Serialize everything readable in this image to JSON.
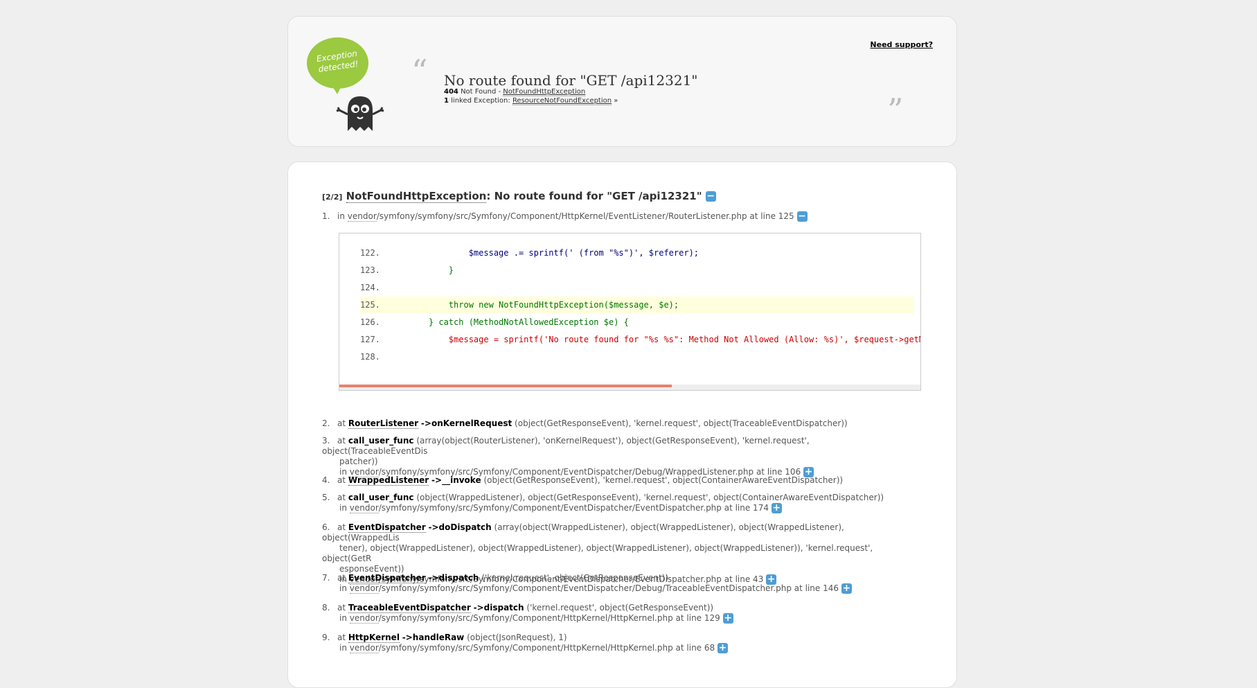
{
  "header": {
    "bubble_text": "Exception detected!",
    "support_link": "Need support?",
    "title": "No route found for \"GET /api12321\"",
    "status_code": "404",
    "status_text": "Not Found -",
    "exception_class": "NotFoundHttpException",
    "linked_count": "1",
    "linked_label": "linked Exception:",
    "linked_class": "ResourceNotFoundException",
    "linked_arrow": "»"
  },
  "exception": {
    "counter": "[2/2]",
    "class": "NotFoundHttpException",
    "message": ": No route found for \"GET /api12321\"",
    "toggle": "−"
  },
  "code": {
    "lines": [
      {
        "n": "122.",
        "code": "            $message .= sprintf(' (from \"%s\")', $referer);"
      },
      {
        "n": "123.",
        "code": "        }"
      },
      {
        "n": "124.",
        "code": ""
      },
      {
        "n": "125.",
        "code": "        throw new NotFoundHttpException($message, $e);"
      },
      {
        "n": "126.",
        "code": "    } catch (MethodNotAllowedException $e) {"
      },
      {
        "n": "127.",
        "code": "        $message = sprintf('No route found for \"%s %s\": Method Not Allowed (Allow: %s)', $request->getMeth"
      },
      {
        "n": "128.",
        "code": ""
      }
    ]
  },
  "trace": [
    {
      "n": "1.",
      "prefix": "in",
      "vendor": "vendor",
      "path": "/symfony/symfony/src/Symfony/Component/HttpKernel/EventListener/RouterListener.php at line 125",
      "toggle": "−"
    },
    {
      "n": "2.",
      "prefix": "at",
      "cls": "RouterListener",
      "fn": "->onKernelRequest",
      "args": "(object(GetResponseEvent), 'kernel.request', object(TraceableEventDispatcher))"
    },
    {
      "n": "3.",
      "prefix": "at",
      "fn": "call_user_func",
      "args": "(array(object(RouterListener), 'onKernelRequest'), object(GetResponseEvent), 'kernel.request', object(TraceableEventDis",
      "args2": "patcher))",
      "vendor": "vendor",
      "path": "/symfony/symfony/src/Symfony/Component/EventDispatcher/Debug/WrappedListener.php at line 106",
      "toggle": "+"
    },
    {
      "n": "4.",
      "prefix": "at",
      "cls": "WrappedListener",
      "fn": "->__invoke",
      "args": "(object(GetResponseEvent), 'kernel.request', object(ContainerAwareEventDispatcher))"
    },
    {
      "n": "5.",
      "prefix": "at",
      "fn": "call_user_func",
      "args": "(object(WrappedListener), object(GetResponseEvent), 'kernel.request', object(ContainerAwareEventDispatcher))",
      "vendor": "vendor",
      "path": "/symfony/symfony/src/Symfony/Component/EventDispatcher/EventDispatcher.php at line 174",
      "toggle": "+"
    },
    {
      "n": "6.",
      "prefix": "at",
      "cls": "EventDispatcher",
      "fn": "->doDispatch",
      "args": "(array(object(WrappedListener), object(WrappedListener), object(WrappedListener), object(WrappedLis",
      "args2": "tener), object(WrappedListener), object(WrappedListener), object(WrappedListener), object(WrappedListener)), 'kernel.request', object(GetR",
      "args3": "esponseEvent))",
      "vendor": "vendor",
      "path": "/symfony/symfony/src/Symfony/Component/EventDispatcher/EventDispatcher.php at line 43",
      "toggle": "+"
    },
    {
      "n": "7.",
      "prefix": "at",
      "cls": "EventDispatcher",
      "fn": "->dispatch",
      "args": "('kernel.request', object(GetResponseEvent))",
      "vendor": "vendor",
      "path": "/symfony/symfony/src/Symfony/Component/EventDispatcher/Debug/TraceableEventDispatcher.php at line 146",
      "toggle": "+"
    },
    {
      "n": "8.",
      "prefix": "at",
      "cls": "TraceableEventDispatcher",
      "fn": "->dispatch",
      "args": "('kernel.request', object(GetResponseEvent))",
      "vendor": "vendor",
      "path": "/symfony/symfony/src/Symfony/Component/HttpKernel/HttpKernel.php at line 129",
      "toggle": "+"
    },
    {
      "n": "9.",
      "prefix": "at",
      "cls": "HttpKernel",
      "fn": "->handleRaw",
      "args": "(object(JsonRequest), 1)",
      "vendor": "vendor",
      "path": "/symfony/symfony/src/Symfony/Component/HttpKernel/HttpKernel.php at line 68",
      "toggle": "+"
    }
  ]
}
